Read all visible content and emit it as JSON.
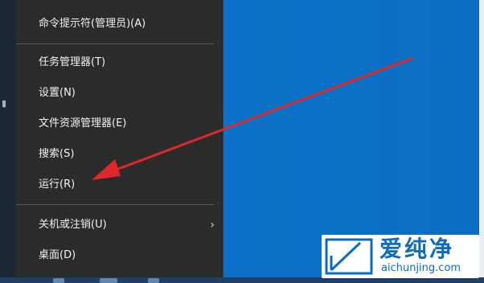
{
  "context_menu": {
    "items": [
      {
        "label": "命令提示符(管理员)(A)"
      },
      {
        "label": "任务管理器(T)"
      },
      {
        "label": "设置(N)"
      },
      {
        "label": "文件资源管理器(E)"
      },
      {
        "label": "搜索(S)"
      },
      {
        "label": "运行(R)"
      },
      {
        "label": "关机或注销(U)",
        "submenu_indicator": "›"
      },
      {
        "label": "桌面(D)"
      }
    ]
  },
  "watermark": {
    "brand": "爱纯净",
    "url": "aichunjing.com"
  },
  "colors": {
    "desktop": "#0a6fc2",
    "menu_bg": "#2b2b2b",
    "menu_text": "#f2f2f2",
    "arrow": "#e0282c",
    "watermark_text": "#0b6cc2"
  }
}
